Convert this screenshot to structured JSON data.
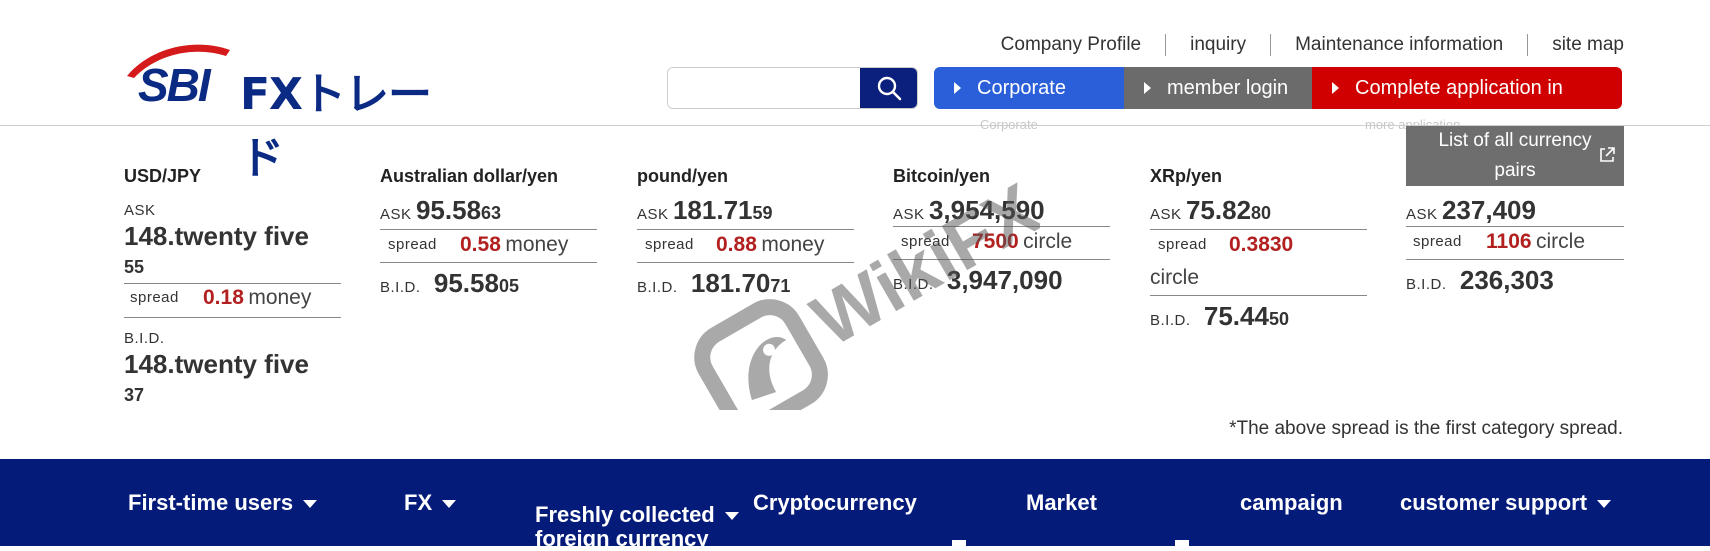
{
  "logo": {
    "sbi": "SBI",
    "fx": "FXトレード"
  },
  "util_links": [
    "Company Profile",
    "inquiry",
    "Maintenance information",
    "site map"
  ],
  "search": {
    "placeholder": "",
    "icon": "search-icon"
  },
  "nav_buttons": {
    "corporate": "Corporate",
    "member": "member login",
    "apply": "Complete application in"
  },
  "ghost_text": {
    "under_corporate": "Corporate",
    "under_apply": "more application"
  },
  "list_all": {
    "line1": "List of all currency",
    "line2": "pairs"
  },
  "labels": {
    "ask": "ASK",
    "bid": "B.I.D.",
    "spread": "spread"
  },
  "rates": {
    "usdjpy": {
      "pair": "USD/JPY",
      "ask_main": "148.twenty five",
      "ask_sub": "55",
      "spread_val": "0.18",
      "spread_unit": "money",
      "bid_main": "148.twenty five",
      "bid_sub": "37"
    },
    "audjpy": {
      "pair": "Australian dollar/yen",
      "ask_main": "95.58",
      "ask_sub": "63",
      "spread_val": "0.58",
      "spread_unit": "money",
      "bid_main": "95.58",
      "bid_sub": "05"
    },
    "gbpjpy": {
      "pair": "pound/yen",
      "ask_main": "181.71",
      "ask_sub": "59",
      "spread_val": "0.88",
      "spread_unit": "money",
      "bid_main": "181.70",
      "bid_sub": "71"
    },
    "btcjpy": {
      "pair": "Bitcoin/yen",
      "ask_main": "3,954,590",
      "spread_val": "7500",
      "spread_unit": "circle",
      "bid_main": "3,947,090"
    },
    "xrpjpy": {
      "pair": "XRp/yen",
      "ask_main": "75.82",
      "ask_sub": "80",
      "spread_val": "0.3830",
      "spread_unit": "circle",
      "bid_main": "75.44",
      "bid_sub": "50"
    },
    "col6": {
      "ask_main": "237,409",
      "spread_val": "1106",
      "spread_unit": "circle",
      "bid_main": "236,303"
    }
  },
  "footnote": "*The above spread is the first category spread.",
  "main_nav": {
    "first_time": "First-time users",
    "fx": "FX",
    "fresh_line1": "Freshly collected",
    "fresh_line2": "foreign currency",
    "crypto": "Cryptocurrency",
    "market": "Market",
    "campaign": "campaign",
    "support": "customer support"
  },
  "watermark": "WikiFX",
  "colors": {
    "brand_navy": "#041b7a",
    "corporate_blue": "#2b5fd9",
    "member_gray": "#6b6b6b",
    "apply_red": "#d00000",
    "spread_red": "#b22020"
  }
}
